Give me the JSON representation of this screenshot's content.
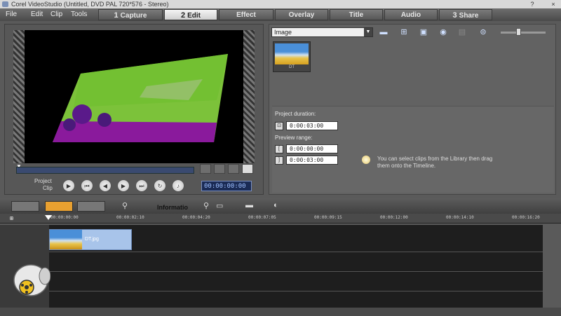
{
  "window": {
    "title": "Corel VideoStudio (Untitled, DVD PAL 720*576 - Stereo)",
    "help": "?",
    "close": "×"
  },
  "menu": [
    "File",
    "Edit",
    "Clip",
    "Tools"
  ],
  "steps": [
    {
      "num": "1",
      "label": "Capture",
      "active": false
    },
    {
      "num": "2",
      "label": "Edit",
      "active": true
    },
    {
      "num": "",
      "label": "Effect",
      "active": false
    },
    {
      "num": "",
      "label": "Overlay",
      "active": false
    },
    {
      "num": "",
      "label": "Title",
      "active": false
    },
    {
      "num": "",
      "label": "Audio",
      "active": false
    },
    {
      "num": "3",
      "label": "Share",
      "active": false
    }
  ],
  "preview": {
    "mode_project": "Project",
    "mode_clip": "Clip",
    "timecode": "00:00:00:00"
  },
  "library": {
    "category": "Image",
    "thumb_label": "DT",
    "icons": [
      "folder-icon",
      "import-icon",
      "capture-icon",
      "record-icon",
      "disabled-icon",
      "sort-icon"
    ]
  },
  "options": {
    "project_duration_label": "Project duration:",
    "project_duration": "0:00:03:00",
    "preview_range_label": "Preview range:",
    "preview_start": "0:00:00:00",
    "preview_end": "0:00:03:00",
    "hint": "You can select clips from the Library then drag them onto the Timeline."
  },
  "timeline": {
    "info_label": "Informatio",
    "ticks": [
      "00:00:00:00",
      "00:00:02:10",
      "00:00:04:20",
      "00:00:07:05",
      "00:00:09:15",
      "00:00:12:00",
      "00:00:14:10",
      "00:00:16:20"
    ],
    "clip_label": "DT.jpg"
  },
  "colors": {
    "accent": "#e8a030",
    "timecode_bg": "#1a2b55",
    "clip": "#a8c4ea"
  }
}
